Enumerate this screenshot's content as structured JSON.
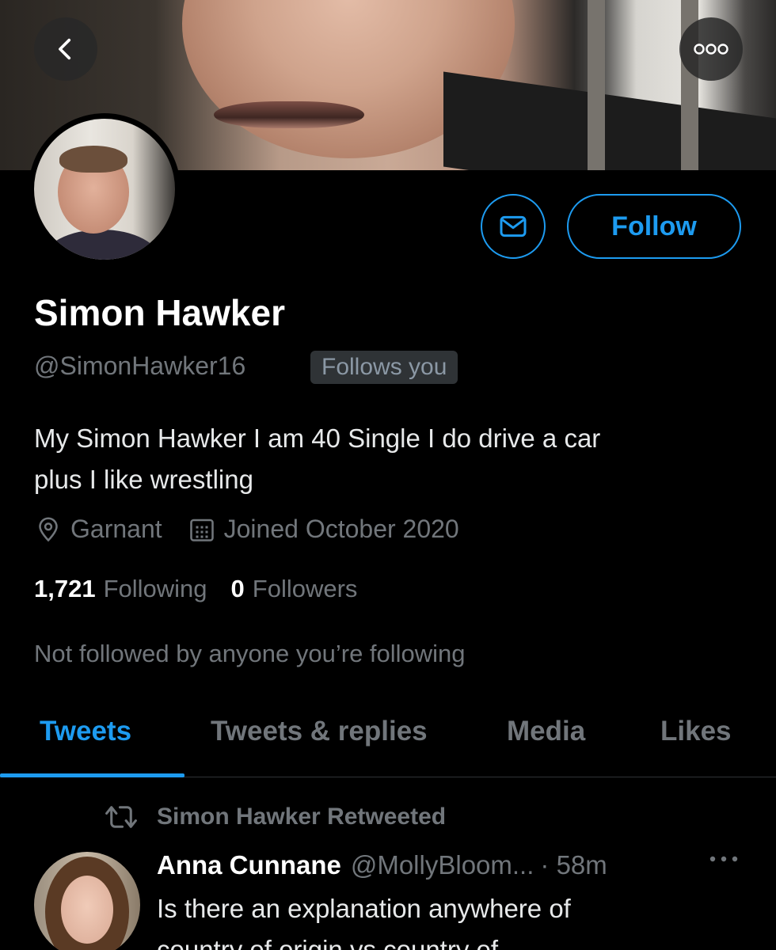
{
  "header": {
    "back_icon": "chevron-left-icon",
    "more_icon": "more-circle-icon"
  },
  "profile": {
    "name": "Simon Hawker",
    "handle": "@SimonHawker16",
    "follows_you": "Follows you",
    "bio_line1": "My Simon Hawker I am 40 Single I do drive a car",
    "bio_line2": "plus I like wrestling",
    "location": "Garnant",
    "joined": "Joined October 2020",
    "following_count": "1,721",
    "following_label": "Following",
    "followers_count": "0",
    "followers_label": "Followers",
    "not_followed": "Not followed by anyone you’re following"
  },
  "actions": {
    "follow_label": "Follow",
    "message_icon": "envelope-icon"
  },
  "tabs": [
    {
      "label": "Tweets",
      "active": true
    },
    {
      "label": "Tweets & replies",
      "active": false
    },
    {
      "label": "Media",
      "active": false
    },
    {
      "label": "Likes",
      "active": false
    }
  ],
  "tweet": {
    "retweeted_by": "Simon Hawker Retweeted",
    "author": "Anna Cunnane",
    "username": "@MollyBloom...",
    "time": "· 58m",
    "text_line1": "Is there an explanation anywhere of",
    "text_line2": "country of origin vs country of"
  },
  "colors": {
    "accent": "#1d9bf0",
    "background": "#000000",
    "muted": "#71767b"
  }
}
